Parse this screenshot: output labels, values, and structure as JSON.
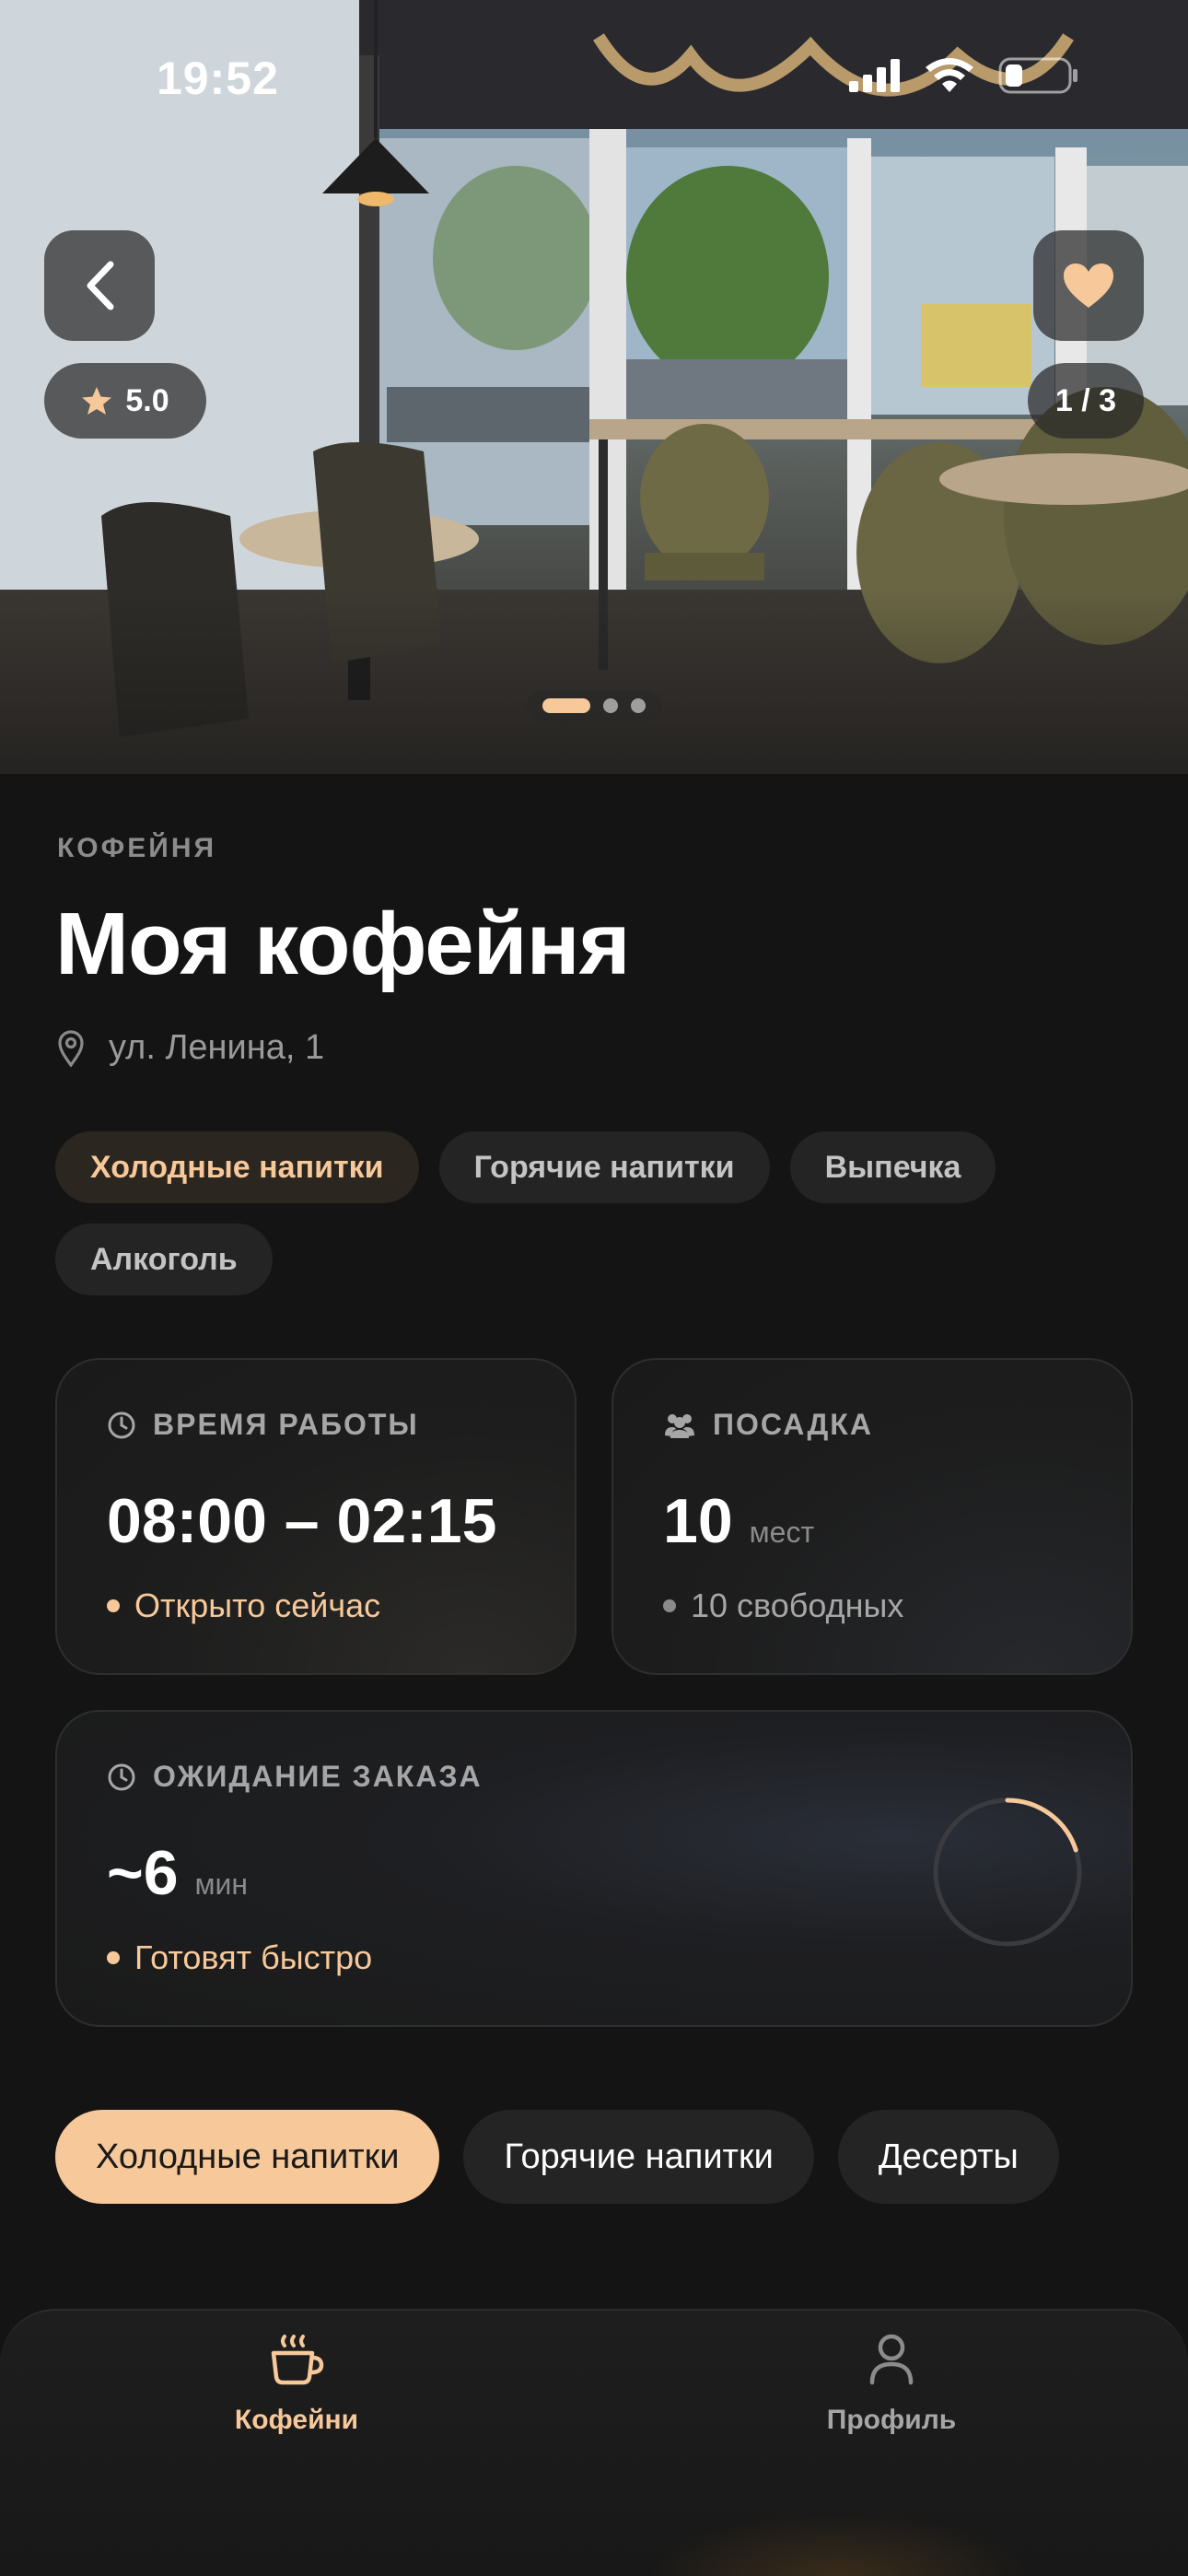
{
  "status_bar": {
    "time": "19:52"
  },
  "hero": {
    "rating": "5.0",
    "photo_counter": "1 / 3",
    "photo_index": 1,
    "photo_total": 3
  },
  "place": {
    "category": "КОФЕЙНЯ",
    "title": "Моя кофейня",
    "address": "ул. Ленина, 1",
    "tags": [
      {
        "label": "Холодные напитки",
        "active": true
      },
      {
        "label": "Горячие напитки",
        "active": false
      },
      {
        "label": "Выпечка",
        "active": false
      },
      {
        "label": "Алкоголь",
        "active": false
      }
    ]
  },
  "cards": {
    "hours": {
      "heading": "ВРЕМЯ РАБОТЫ",
      "value": "08:00 – 02:15",
      "status": "Открыто сейчас"
    },
    "seats": {
      "heading": "ПОСАДКА",
      "value": "10",
      "unit": "мест",
      "status": "10 свободных"
    },
    "wait": {
      "heading": "ОЖИДАНИЕ ЗАКАЗА",
      "value": "~6",
      "unit": "мин",
      "status": "Готовят быстро",
      "progress": 0.2
    }
  },
  "menu_tabs": [
    {
      "label": "Холодные напитки",
      "active": true
    },
    {
      "label": "Горячие напитки",
      "active": false
    },
    {
      "label": "Десерты",
      "active": false
    }
  ],
  "bottom_nav": {
    "items": [
      {
        "label": "Кофейни",
        "icon": "coffee-cup-icon",
        "active": true
      },
      {
        "label": "Профиль",
        "icon": "person-icon",
        "active": false
      }
    ]
  },
  "colors": {
    "accent": "#f6c89a",
    "background": "#141414",
    "card": "#1c1c1c",
    "muted_text": "#9a9a9a"
  }
}
